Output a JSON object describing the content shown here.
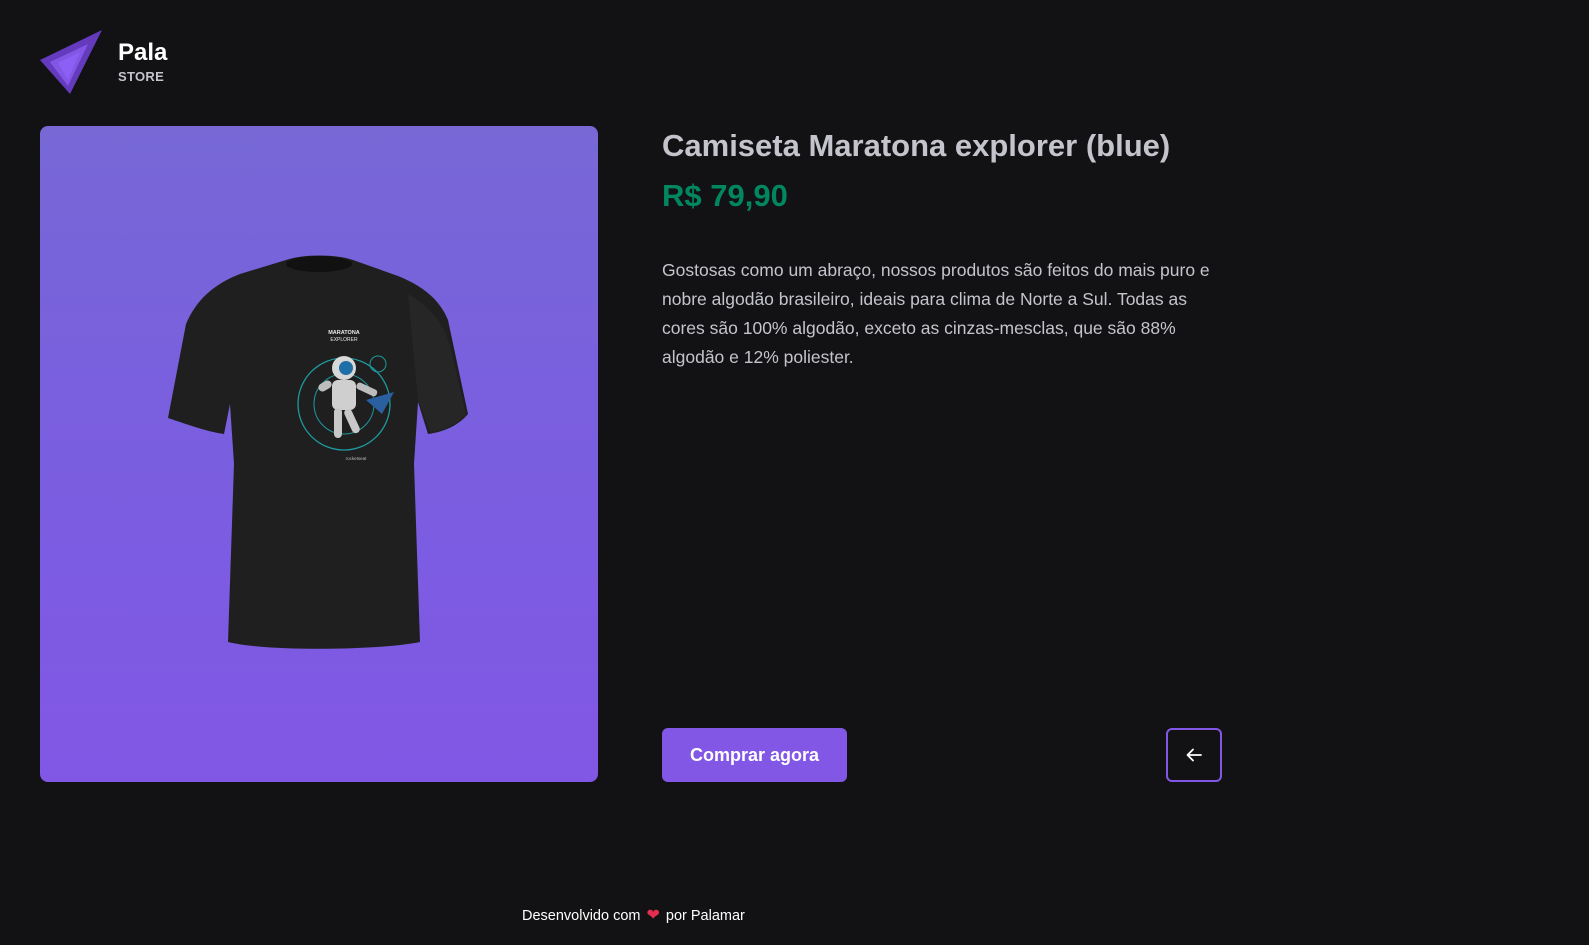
{
  "brand": {
    "name": "Pala",
    "subtitle": "STORE",
    "accent_color": "#8257e5"
  },
  "product": {
    "title": "Camiseta Maratona explorer (blue)",
    "price": "R$ 79,90",
    "description": "Gostosas como um abraço, nossos produtos são feitos do mais puro e nobre algodão brasileiro, ideais para clima de Norte a Sul. Todas as cores são 100% algodão, exceto as cinzas-mesclas, que são 88% algodão e 12% poliester.",
    "image_print_title": "MARATONA",
    "image_print_subtitle": "EXPLORER",
    "image_print_brand": "rocketseat",
    "price_color": "#00875f"
  },
  "actions": {
    "buy_label": "Comprar agora",
    "back_icon": "arrow-left-icon"
  },
  "footer": {
    "prefix": "Desenvolvido com",
    "heart_icon": "heart-icon",
    "heart_glyph": "❤",
    "suffix": "por Palamar"
  }
}
